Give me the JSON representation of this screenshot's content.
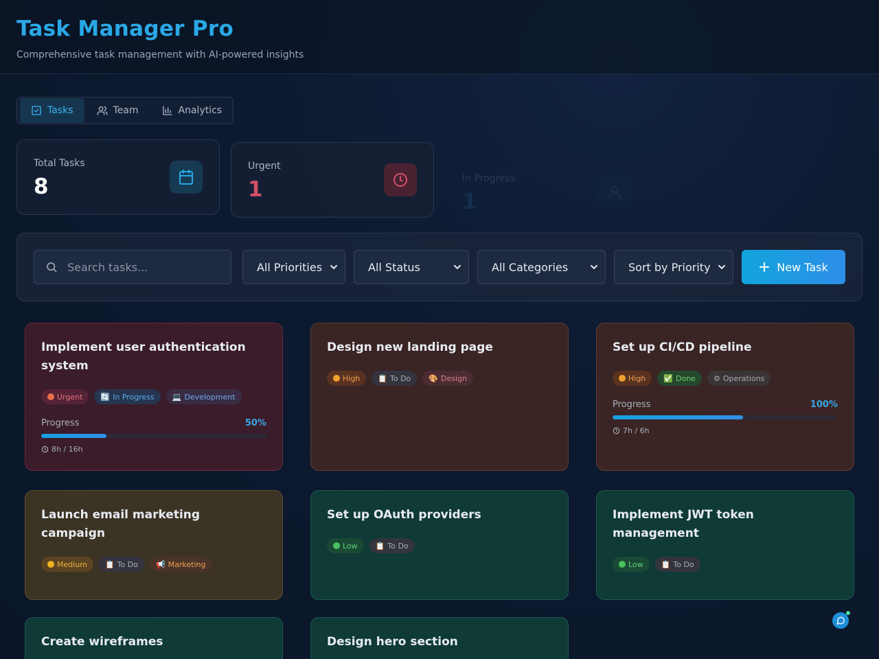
{
  "header": {
    "title": "Task Manager Pro",
    "subtitle": "Comprehensive task management with AI-powered insights"
  },
  "tabs": [
    {
      "label": "Tasks",
      "icon": "check-square-icon",
      "active": true
    },
    {
      "label": "Team",
      "icon": "users-icon",
      "active": false
    },
    {
      "label": "Analytics",
      "icon": "bar-chart-icon",
      "active": false
    }
  ],
  "stats": [
    {
      "label": "Total Tasks",
      "value": "8",
      "icon": "calendar-icon",
      "color": "#ffffff",
      "accent": "#2aa8e6"
    },
    {
      "label": "Urgent",
      "value": "1",
      "icon": "clock-icon",
      "color": "#d05068",
      "accent": "#d05068"
    },
    {
      "label": "In Progress",
      "value": "1",
      "icon": "user-icon",
      "color": "#3a78b8",
      "accent": "#3a78b8"
    }
  ],
  "filters": {
    "search_placeholder": "Search tasks...",
    "priority": "All Priorities",
    "status": "All Status",
    "category": "All Categories",
    "sort": "Sort by Priority",
    "new_task_label": "New Task"
  },
  "tasks": [
    {
      "title": "Implement user authentication system",
      "priority": "Urgent",
      "status": "In Progress",
      "category": "Development",
      "progress_label": "Progress",
      "progress_text": "50%",
      "progress": 0.29,
      "hours": "8h / 16h"
    },
    {
      "title": "Design new landing page",
      "priority": "High",
      "status": "To Do",
      "category": "Design"
    },
    {
      "title": "Set up CI/CD pipeline",
      "priority": "High",
      "status": "Done",
      "category": "Operations",
      "progress_label": "Progress",
      "progress_text": "100%",
      "progress": 0.58,
      "hours": "7h / 6h"
    },
    {
      "title": "Launch email marketing campaign",
      "priority": "Medium",
      "status": "To Do",
      "category": "Marketing"
    },
    {
      "title": "Set up OAuth providers",
      "priority": "Low",
      "status": "To Do"
    },
    {
      "title": "Implement JWT token management",
      "priority": "Low",
      "status": "To Do"
    },
    {
      "title": "Create wireframes"
    },
    {
      "title": "Design hero section"
    }
  ]
}
